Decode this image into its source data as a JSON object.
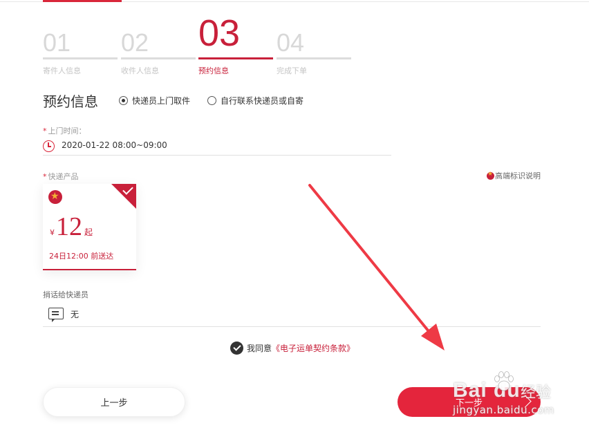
{
  "steps": [
    {
      "num": "01",
      "label": "寄件人信息",
      "active": false
    },
    {
      "num": "02",
      "label": "收件人信息",
      "active": false
    },
    {
      "num": "03",
      "label": "预约信息",
      "active": true
    },
    {
      "num": "04",
      "label": "完成下单",
      "active": false
    }
  ],
  "section": {
    "title": "预约信息",
    "options": [
      {
        "label": "快递员上门取件",
        "checked": true
      },
      {
        "label": "自行联系快递员或自寄",
        "checked": false
      }
    ]
  },
  "pickup": {
    "required_mark": "*",
    "label": "上门时间：",
    "value": "2020-01-22 08:00~09:00"
  },
  "product": {
    "required_mark": "*",
    "label": "快递产品",
    "legend": "高端标识说明",
    "card": {
      "currency": "¥",
      "price": "12",
      "price_suffix": "起",
      "eta": "24日12:00 前送达",
      "selected": true
    }
  },
  "message": {
    "label": "捎话给快递员",
    "value": "无"
  },
  "agreement": {
    "prefix": "我同意",
    "link": "《电子运单契约条款》",
    "checked": true
  },
  "buttons": {
    "prev": "上一步",
    "next": "下一步"
  },
  "watermark": {
    "logo": "Bai du",
    "cn": "经验",
    "url": "jingyan.baidu.com"
  },
  "colors": {
    "accent": "#c8203a",
    "button_primary": "#e4253c"
  }
}
